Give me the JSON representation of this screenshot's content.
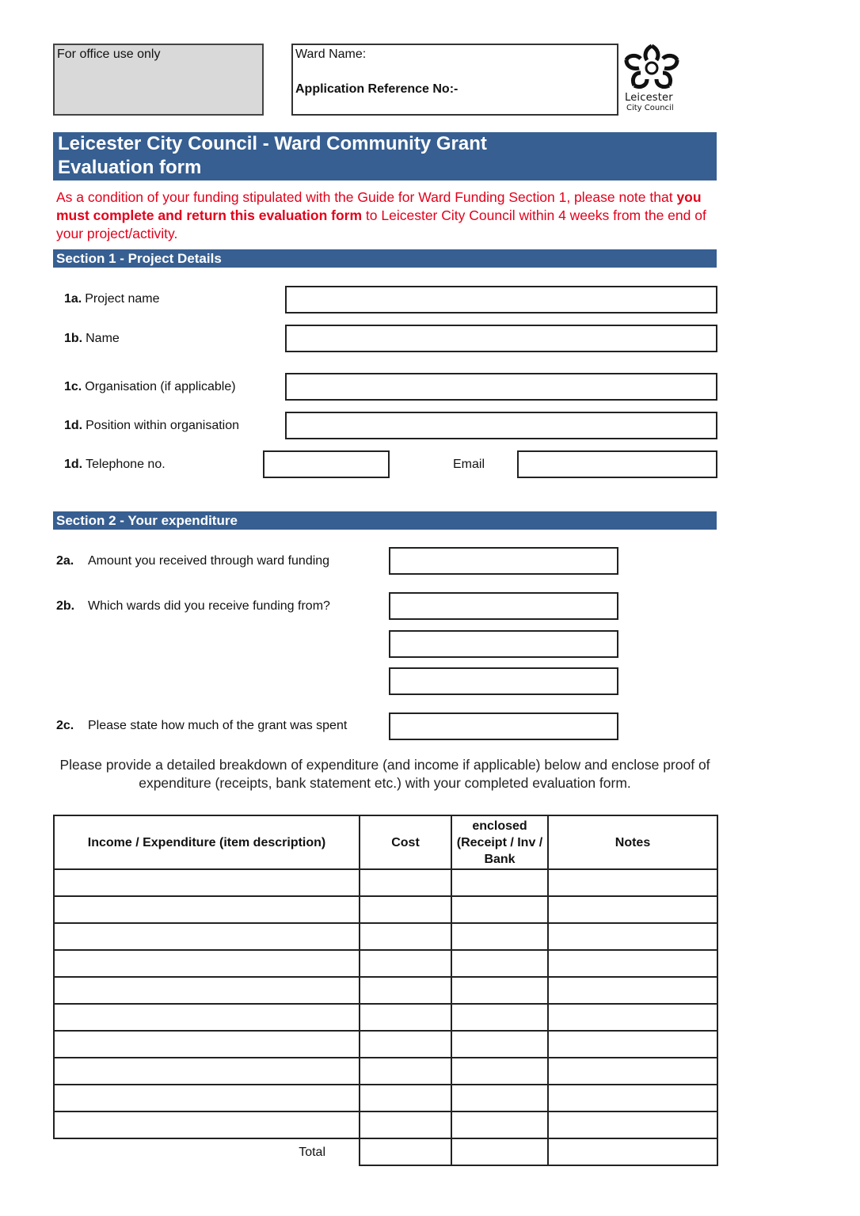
{
  "header": {
    "office_label": "For office use only",
    "ward_name_label": "Ward Name:",
    "app_ref_label": "Application Reference No:-",
    "logo": {
      "icon": "leicester-rose-icon",
      "line1": "Leicester",
      "line2": "City Council"
    }
  },
  "title": {
    "line1": "Leicester City Council -  Ward Community Grant",
    "line2": "Evaluation form"
  },
  "notice": {
    "part1": "As a condition of your funding stipulated with the Guide for Ward Funding Section 1, please note that ",
    "bold": "you must complete and return this evaluation form",
    "part2": " to Leicester City Council within 4 weeks from the end of your project/activity."
  },
  "section1": {
    "heading": "Section 1 - Project Details",
    "fields": [
      {
        "num": "1a.",
        "label": "Project name",
        "value": ""
      },
      {
        "num": "1b.",
        "label": "Name",
        "value": ""
      },
      {
        "num": "1c.",
        "label": "Organisation (if applicable)",
        "value": ""
      },
      {
        "num": "1d.",
        "label": "Position within organisation",
        "value": ""
      },
      {
        "num": "1d.",
        "label": "Telephone no.",
        "value": ""
      }
    ],
    "email_label": "Email",
    "email_value": ""
  },
  "section2": {
    "heading": "Section 2 - Your expenditure",
    "fields": [
      {
        "num": "2a.",
        "label": "Amount you received through ward funding",
        "value": ""
      },
      {
        "num": "2b.",
        "label": "Which wards did you receive funding from?",
        "values": [
          "",
          "",
          ""
        ]
      },
      {
        "num": "2c.",
        "label": "Please state how much of the grant was spent",
        "value": ""
      }
    ],
    "instruction": "Please provide a detailed breakdown of expenditure (and income if applicable) below and enclose proof of expenditure (receipts, bank statement etc.) with your completed evaluation form."
  },
  "table": {
    "headers": [
      "Income / Expenditure (item description)",
      "Cost",
      "enclosed (Receipt / Inv / Bank",
      "Notes"
    ],
    "rows": [
      [
        "",
        "",
        "",
        ""
      ],
      [
        "",
        "",
        "",
        ""
      ],
      [
        "",
        "",
        "",
        ""
      ],
      [
        "",
        "",
        "",
        ""
      ],
      [
        "",
        "",
        "",
        ""
      ],
      [
        "",
        "",
        "",
        ""
      ],
      [
        "",
        "",
        "",
        ""
      ],
      [
        "",
        "",
        "",
        ""
      ],
      [
        "",
        "",
        "",
        ""
      ],
      [
        "",
        "",
        "",
        ""
      ]
    ],
    "total_label": "Total"
  }
}
